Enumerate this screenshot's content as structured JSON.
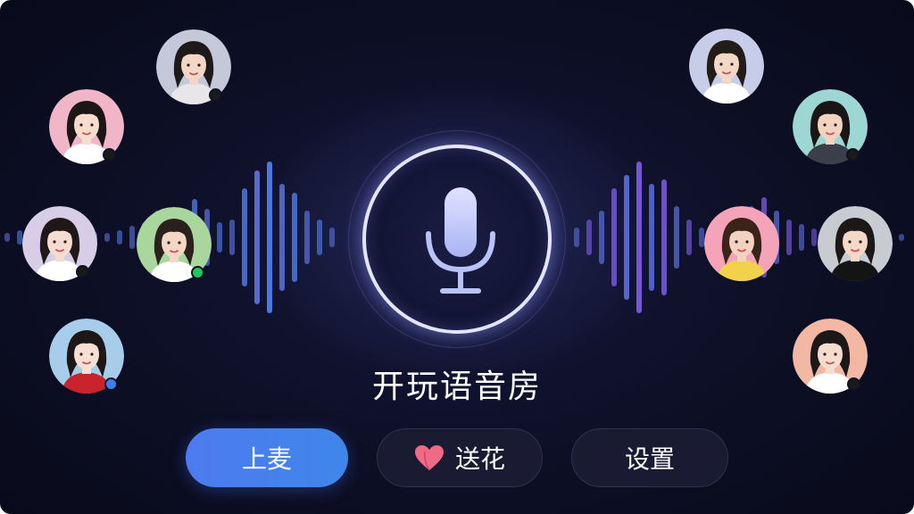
{
  "room": {
    "title": "开玩语音房"
  },
  "actions": {
    "join_mic_label": "上麦",
    "send_flower_label": "送花",
    "settings_label": "设置"
  },
  "icons": {
    "center": "microphone-icon",
    "flower_button": "heart-icon"
  },
  "colors": {
    "primary_button": "#4a7ff0",
    "dark_button": "#1a1b33",
    "heart": "#f06a85",
    "wave_left": "#4f7dea",
    "wave_right": "#7a5ae0",
    "mic_ring": "#e4e6ff",
    "status_online": "#22c55e",
    "status_blue": "#3b7ff0",
    "status_dark": "#1a1a1a"
  },
  "seats": [
    {
      "id": "left-1",
      "bg": "#c5c8d8",
      "hair": "#1f1a1a",
      "skin": "#f3d7c6",
      "shirt": "#e8e6ea",
      "status": "dark"
    },
    {
      "id": "left-2",
      "bg": "#f0b6c8",
      "hair": "#1c1616",
      "skin": "#f5dccd",
      "shirt": "#ffffff",
      "status": "dark"
    },
    {
      "id": "left-3",
      "bg": "#d8cde6",
      "hair": "#1e1818",
      "skin": "#f6dccf",
      "shirt": "#ffffff",
      "status": "dark"
    },
    {
      "id": "left-4",
      "bg": "#a9d69c",
      "hair": "#2a201c",
      "skin": "#f3d6c4",
      "shirt": "#ffffff",
      "status": "online"
    },
    {
      "id": "left-5",
      "bg": "#a7cdeb",
      "hair": "#1d1717",
      "skin": "#f7dfd2",
      "shirt": "#c9232d",
      "status": "blue"
    },
    {
      "id": "right-1",
      "bg": "#c7cde8",
      "hair": "#241c19",
      "skin": "#f3d8c8",
      "shirt": "#ffffff",
      "status": "none"
    },
    {
      "id": "right-2",
      "bg": "#9ed6d3",
      "hair": "#1a1616",
      "skin": "#f1d3bf",
      "shirt": "#3a3f4a",
      "status": "dark"
    },
    {
      "id": "right-3",
      "bg": "#f4a3b8",
      "hair": "#3a2418",
      "skin": "#f2d2c0",
      "shirt": "#f2d24a",
      "status": "none"
    },
    {
      "id": "right-4",
      "bg": "#c9cbd3",
      "hair": "#1c1818",
      "skin": "#f3d8c8",
      "shirt": "#141414",
      "status": "none"
    },
    {
      "id": "right-5",
      "bg": "#f2b8a4",
      "hair": "#1d1717",
      "skin": "#f6dccd",
      "shirt": "#ffffff",
      "status": "dark"
    }
  ]
}
